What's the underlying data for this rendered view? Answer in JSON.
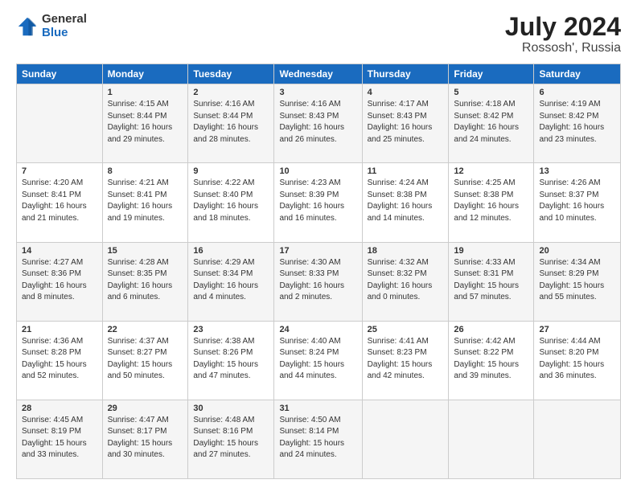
{
  "logo": {
    "general": "General",
    "blue": "Blue"
  },
  "title": "July 2024",
  "location": "Rossosh', Russia",
  "days_header": [
    "Sunday",
    "Monday",
    "Tuesday",
    "Wednesday",
    "Thursday",
    "Friday",
    "Saturday"
  ],
  "weeks": [
    [
      {
        "num": "",
        "info": ""
      },
      {
        "num": "1",
        "info": "Sunrise: 4:15 AM\nSunset: 8:44 PM\nDaylight: 16 hours\nand 29 minutes."
      },
      {
        "num": "2",
        "info": "Sunrise: 4:16 AM\nSunset: 8:44 PM\nDaylight: 16 hours\nand 28 minutes."
      },
      {
        "num": "3",
        "info": "Sunrise: 4:16 AM\nSunset: 8:43 PM\nDaylight: 16 hours\nand 26 minutes."
      },
      {
        "num": "4",
        "info": "Sunrise: 4:17 AM\nSunset: 8:43 PM\nDaylight: 16 hours\nand 25 minutes."
      },
      {
        "num": "5",
        "info": "Sunrise: 4:18 AM\nSunset: 8:42 PM\nDaylight: 16 hours\nand 24 minutes."
      },
      {
        "num": "6",
        "info": "Sunrise: 4:19 AM\nSunset: 8:42 PM\nDaylight: 16 hours\nand 23 minutes."
      }
    ],
    [
      {
        "num": "7",
        "info": "Sunrise: 4:20 AM\nSunset: 8:41 PM\nDaylight: 16 hours\nand 21 minutes."
      },
      {
        "num": "8",
        "info": "Sunrise: 4:21 AM\nSunset: 8:41 PM\nDaylight: 16 hours\nand 19 minutes."
      },
      {
        "num": "9",
        "info": "Sunrise: 4:22 AM\nSunset: 8:40 PM\nDaylight: 16 hours\nand 18 minutes."
      },
      {
        "num": "10",
        "info": "Sunrise: 4:23 AM\nSunset: 8:39 PM\nDaylight: 16 hours\nand 16 minutes."
      },
      {
        "num": "11",
        "info": "Sunrise: 4:24 AM\nSunset: 8:38 PM\nDaylight: 16 hours\nand 14 minutes."
      },
      {
        "num": "12",
        "info": "Sunrise: 4:25 AM\nSunset: 8:38 PM\nDaylight: 16 hours\nand 12 minutes."
      },
      {
        "num": "13",
        "info": "Sunrise: 4:26 AM\nSunset: 8:37 PM\nDaylight: 16 hours\nand 10 minutes."
      }
    ],
    [
      {
        "num": "14",
        "info": "Sunrise: 4:27 AM\nSunset: 8:36 PM\nDaylight: 16 hours\nand 8 minutes."
      },
      {
        "num": "15",
        "info": "Sunrise: 4:28 AM\nSunset: 8:35 PM\nDaylight: 16 hours\nand 6 minutes."
      },
      {
        "num": "16",
        "info": "Sunrise: 4:29 AM\nSunset: 8:34 PM\nDaylight: 16 hours\nand 4 minutes."
      },
      {
        "num": "17",
        "info": "Sunrise: 4:30 AM\nSunset: 8:33 PM\nDaylight: 16 hours\nand 2 minutes."
      },
      {
        "num": "18",
        "info": "Sunrise: 4:32 AM\nSunset: 8:32 PM\nDaylight: 16 hours\nand 0 minutes."
      },
      {
        "num": "19",
        "info": "Sunrise: 4:33 AM\nSunset: 8:31 PM\nDaylight: 15 hours\nand 57 minutes."
      },
      {
        "num": "20",
        "info": "Sunrise: 4:34 AM\nSunset: 8:29 PM\nDaylight: 15 hours\nand 55 minutes."
      }
    ],
    [
      {
        "num": "21",
        "info": "Sunrise: 4:36 AM\nSunset: 8:28 PM\nDaylight: 15 hours\nand 52 minutes."
      },
      {
        "num": "22",
        "info": "Sunrise: 4:37 AM\nSunset: 8:27 PM\nDaylight: 15 hours\nand 50 minutes."
      },
      {
        "num": "23",
        "info": "Sunrise: 4:38 AM\nSunset: 8:26 PM\nDaylight: 15 hours\nand 47 minutes."
      },
      {
        "num": "24",
        "info": "Sunrise: 4:40 AM\nSunset: 8:24 PM\nDaylight: 15 hours\nand 44 minutes."
      },
      {
        "num": "25",
        "info": "Sunrise: 4:41 AM\nSunset: 8:23 PM\nDaylight: 15 hours\nand 42 minutes."
      },
      {
        "num": "26",
        "info": "Sunrise: 4:42 AM\nSunset: 8:22 PM\nDaylight: 15 hours\nand 39 minutes."
      },
      {
        "num": "27",
        "info": "Sunrise: 4:44 AM\nSunset: 8:20 PM\nDaylight: 15 hours\nand 36 minutes."
      }
    ],
    [
      {
        "num": "28",
        "info": "Sunrise: 4:45 AM\nSunset: 8:19 PM\nDaylight: 15 hours\nand 33 minutes."
      },
      {
        "num": "29",
        "info": "Sunrise: 4:47 AM\nSunset: 8:17 PM\nDaylight: 15 hours\nand 30 minutes."
      },
      {
        "num": "30",
        "info": "Sunrise: 4:48 AM\nSunset: 8:16 PM\nDaylight: 15 hours\nand 27 minutes."
      },
      {
        "num": "31",
        "info": "Sunrise: 4:50 AM\nSunset: 8:14 PM\nDaylight: 15 hours\nand 24 minutes."
      },
      {
        "num": "",
        "info": ""
      },
      {
        "num": "",
        "info": ""
      },
      {
        "num": "",
        "info": ""
      }
    ]
  ]
}
